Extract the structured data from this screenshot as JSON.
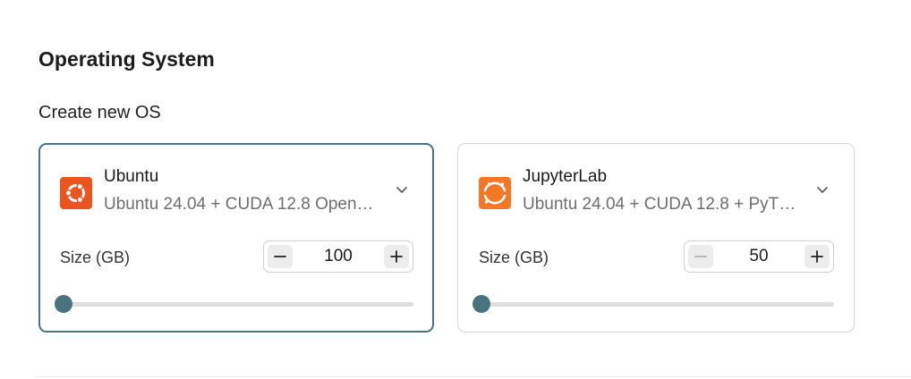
{
  "section": {
    "title": "Operating System",
    "subtitle": "Create new OS"
  },
  "colors": {
    "accent": "#4a7380",
    "ubuntu_brand": "#e95420",
    "jupyter_brand": "#f37726"
  },
  "os_cards": [
    {
      "name": "Ubuntu",
      "description": "Ubuntu 24.04 + CUDA 12.8 Open…",
      "logo_icon": "ubuntu-logo-icon",
      "selected": true,
      "size_label": "Size (GB)",
      "size_value": "100",
      "slider_fraction": 0.0
    },
    {
      "name": "JupyterLab",
      "description": "Ubuntu 24.04 + CUDA 12.8 + PyT…",
      "logo_icon": "jupyterlab-logo-icon",
      "selected": false,
      "size_label": "Size (GB)",
      "size_value": "50",
      "slider_fraction": 0.0
    }
  ]
}
